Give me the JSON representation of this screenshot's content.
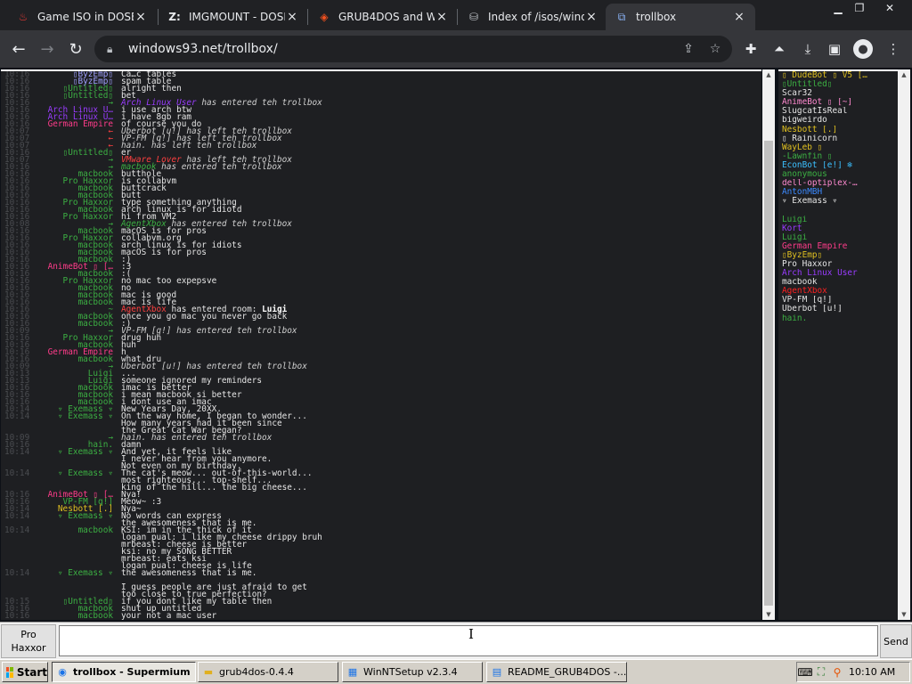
{
  "browser": {
    "tabs": [
      {
        "label": "Game ISO in DOSB",
        "icon": "fire-icon",
        "active": false
      },
      {
        "label": "IMGMOUNT - DOSB",
        "icon": "z-icon",
        "active": false
      },
      {
        "label": "GRUB4DOS and W",
        "icon": "diamond-icon",
        "active": false
      },
      {
        "label": "Index of /isos/windo",
        "icon": "folder-icon",
        "active": false
      },
      {
        "label": "trollbox",
        "icon": "trollbox-icon",
        "active": true
      }
    ],
    "new_tab_close": "×",
    "url": "windows93.net/trollbox/"
  },
  "chat": {
    "messages": [
      {
        "t": "10:16",
        "n": "▯ByzEmp▯",
        "x": "Ca…c tables",
        "nc": "#a0a0ff"
      },
      {
        "t": "10:16",
        "n": "▯ByzEmp▯",
        "x": "spam table",
        "nc": "#a0a0ff"
      },
      {
        "t": "10:16",
        "n": "▯Untitled▯",
        "x": "alright then",
        "nc": "#3cb043"
      },
      {
        "t": "10:16",
        "n": "▯Untitled▯",
        "x": "bet",
        "nc": "#3cb043"
      },
      {
        "t": "10:16",
        "n": "→",
        "x": "Arch Linux User has entered teh trollbox",
        "sys": true,
        "nc": "#3cb043",
        "hl": "Arch Linux User",
        "hc": "#9a3cff"
      },
      {
        "t": "10:16",
        "n": "Arch Linux U…",
        "x": "i use arch btw",
        "nc": "#9a3cff"
      },
      {
        "t": "10:16",
        "n": "Arch Linux U…",
        "x": "i have 8gb ram",
        "nc": "#9a3cff"
      },
      {
        "t": "10:16",
        "n": "German Empire",
        "x": "of course you do",
        "nc": "#ff3c8a"
      },
      {
        "t": "10:07",
        "n": "←",
        "x": "Uberbot [u!] has left teh trollbox",
        "sys": true,
        "nc": "#ff4040"
      },
      {
        "t": "10:07",
        "n": "←",
        "x": "VP-FM [q!] has left teh trollbox",
        "sys": true,
        "nc": "#ff4040"
      },
      {
        "t": "10:07",
        "n": "←",
        "x": "hain. has left teh trollbox",
        "sys": true,
        "nc": "#ff4040"
      },
      {
        "t": "10:16",
        "n": "▯Untitled▯",
        "x": "er",
        "nc": "#3cb043"
      },
      {
        "t": "10:07",
        "n": "→",
        "x": "VMware Lover has left teh trollbox",
        "sys": true,
        "nc": "#3cb043",
        "hl": "VMware Lover",
        "hc": "#ff4040"
      },
      {
        "t": "10:16",
        "n": "→",
        "x": "macbook has entered teh trollbox",
        "sys": true,
        "nc": "#3cb043",
        "hl": "macbook",
        "hc": "#3cb043"
      },
      {
        "t": "10:16",
        "n": "macbook",
        "x": "butthole",
        "nc": "#3cb043"
      },
      {
        "t": "10:16",
        "n": "Pro Haxxor",
        "x": "is collabvm",
        "nc": "#3cb043"
      },
      {
        "t": "10:16",
        "n": "macbook",
        "x": "buttcrack",
        "nc": "#3cb043"
      },
      {
        "t": "10:16",
        "n": "macbook",
        "x": "butt",
        "nc": "#3cb043"
      },
      {
        "t": "10:16",
        "n": "Pro Haxxor",
        "x": "type something anything",
        "nc": "#3cb043"
      },
      {
        "t": "10:16",
        "n": "macbook",
        "x": "arch linux is for idiotd",
        "nc": "#3cb043"
      },
      {
        "t": "10:16",
        "n": "Pro Haxxor",
        "x": "hi from VM2",
        "nc": "#3cb043"
      },
      {
        "t": "10:08",
        "n": "→",
        "x": "AgentXbox has entered teh trollbox",
        "sys": true,
        "nc": "#3cb043",
        "hl": "AgentXbox",
        "hc": "#3cb043"
      },
      {
        "t": "10:16",
        "n": "macbook",
        "x": "macOS is for pros",
        "nc": "#3cb043"
      },
      {
        "t": "10:16",
        "n": "Pro Haxxor",
        "x": "collabvm.org",
        "nc": "#3cb043"
      },
      {
        "t": "10:16",
        "n": "macbook",
        "x": "arch linux is for idiots",
        "nc": "#3cb043"
      },
      {
        "t": "10:16",
        "n": "macbook",
        "x": "macOS is for pros",
        "nc": "#3cb043"
      },
      {
        "t": "10:16",
        "n": "macbook",
        "x": ":)",
        "nc": "#3cb043"
      },
      {
        "t": "10:16",
        "n": "AnimeBot ▯ […",
        "x": ":3",
        "nc": "#ff3c8a"
      },
      {
        "t": "10:16",
        "n": "macbook",
        "x": ":(",
        "nc": "#3cb043"
      },
      {
        "t": "10:16",
        "n": "Pro Haxxor",
        "x": "no mac too expepsve",
        "nc": "#3cb043"
      },
      {
        "t": "10:16",
        "n": "macbook",
        "x": "no",
        "nc": "#3cb043"
      },
      {
        "t": "10:16",
        "n": "macbook",
        "x": "mac is good",
        "nc": "#3cb043"
      },
      {
        "t": "10:16",
        "n": "macbook",
        "x": "mac is life",
        "nc": "#3cb043"
      },
      {
        "t": "10:16",
        "n": "~",
        "x": "AgentXbox has entered room: Luigi",
        "sys": false,
        "nc": "#3cb043",
        "hl": "AgentXbox",
        "hc": "#ff4040",
        "bold": "Luigi"
      },
      {
        "t": "10:16",
        "n": "macbook",
        "x": "once you go mac you never go back",
        "nc": "#3cb043"
      },
      {
        "t": "10:16",
        "n": "macbook",
        "x": ":)",
        "nc": "#3cb043"
      },
      {
        "t": "10:09",
        "n": "→",
        "x": "VP-FM [q!] has entered teh trollbox",
        "sys": true,
        "nc": "#3cb043"
      },
      {
        "t": "10:16",
        "n": "Pro Haxxor",
        "x": "drug huh",
        "nc": "#3cb043"
      },
      {
        "t": "10:16",
        "n": "macbook",
        "x": "huh",
        "nc": "#3cb043"
      },
      {
        "t": "10:16",
        "n": "German Empire",
        "x": "h",
        "nc": "#ff3c8a"
      },
      {
        "t": "10:16",
        "n": "macbook",
        "x": "what dru",
        "nc": "#3cb043"
      },
      {
        "t": "10:09",
        "n": "→",
        "x": "Uberbot [u!] has entered teh trollbox",
        "sys": true,
        "nc": "#3cb043"
      },
      {
        "t": "10:13",
        "n": "Luigi",
        "x": "...",
        "nc": "#3cb043"
      },
      {
        "t": "10:13",
        "n": "Luigi",
        "x": "someone ignored my reminders",
        "nc": "#3cb043"
      },
      {
        "t": "10:16",
        "n": "macbook",
        "x": "imac is better",
        "nc": "#3cb043"
      },
      {
        "t": "10:16",
        "n": "macbook",
        "x": "i mean macbook si better",
        "nc": "#3cb043"
      },
      {
        "t": "10:16",
        "n": "macbook",
        "x": "i dont use an imac",
        "nc": "#3cb043"
      },
      {
        "t": "10:14",
        "n": "▿ Exemass ▿",
        "x": "New Years Day, 20XX.",
        "nc": "#3cb043"
      },
      {
        "t": "10:14",
        "n": "▿ Exemass ▿",
        "x": "On the way home, I began to wonder...",
        "nc": "#3cb043"
      },
      {
        "t": "",
        "n": "",
        "x": "How many years had it been since",
        "nc": "#3cb043"
      },
      {
        "t": "",
        "n": "",
        "x": "the Great Cat War began?",
        "nc": "#3cb043"
      },
      {
        "t": "10:09",
        "n": "→",
        "x": "hain. has entered teh trollbox",
        "sys": true,
        "nc": "#3cb043"
      },
      {
        "t": "10:16",
        "n": "hain.",
        "x": "damn",
        "nc": "#3cb043"
      },
      {
        "t": "10:14",
        "n": "▿ Exemass ▿",
        "x": "And yet, it feels like",
        "nc": "#3cb043"
      },
      {
        "t": "",
        "n": "",
        "x": "I never hear from you anymore.",
        "nc": "#3cb043"
      },
      {
        "t": "",
        "n": "",
        "x": "Not even on my birthday.",
        "nc": "#3cb043"
      },
      {
        "t": "10:14",
        "n": "▿ Exemass ▿",
        "x": "The cat's meow... out-of-this-world...",
        "nc": "#3cb043"
      },
      {
        "t": "",
        "n": "",
        "x": "most righteous... top-shelf...",
        "nc": "#3cb043"
      },
      {
        "t": "",
        "n": "",
        "x": "king of the hill... the big cheese...",
        "nc": "#3cb043"
      },
      {
        "t": "10:16",
        "n": "AnimeBot ▯ […",
        "x": "Nya!",
        "nc": "#ff3c8a"
      },
      {
        "t": "10:16",
        "n": "VP-FM [q!]",
        "x": "Meow~ :3",
        "nc": "#3cb043"
      },
      {
        "t": "10:14",
        "n": "Nesbott [.]",
        "x": "Nya~",
        "nc": "#e0c020"
      },
      {
        "t": "10:14",
        "n": "▿ Exemass ▿",
        "x": "No words can express",
        "nc": "#3cb043"
      },
      {
        "t": "",
        "n": "",
        "x": "the awesomeness that is me.",
        "nc": "#3cb043"
      },
      {
        "t": "10:14",
        "n": "macbook",
        "x": "KSI: im in the thick of it",
        "nc": "#3cb043"
      },
      {
        "t": "",
        "n": "",
        "x": "logan pual: i like my cheese drippy bruh",
        "nc": "#3cb043"
      },
      {
        "t": "",
        "n": "",
        "x": "mrbeast: cheese is better",
        "nc": "#3cb043"
      },
      {
        "t": "",
        "n": "",
        "x": "ksi: no my SONG BETTER",
        "nc": "#3cb043"
      },
      {
        "t": "",
        "n": "",
        "x": "mrbeast: eats ksi",
        "nc": "#3cb043"
      },
      {
        "t": "",
        "n": "",
        "x": "logan pual: cheese is life",
        "nc": "#3cb043"
      },
      {
        "t": "10:14",
        "n": "▿ Exemass ▿",
        "x": "the awesomeness that is me.",
        "nc": "#3cb043"
      },
      {
        "t": "",
        "n": "",
        "x": "",
        "nc": "#3cb043"
      },
      {
        "t": "",
        "n": "",
        "x": "I guess people are just afraid to get",
        "nc": "#3cb043"
      },
      {
        "t": "",
        "n": "",
        "x": "too close to true perfection?",
        "nc": "#3cb043"
      },
      {
        "t": "10:15",
        "n": "▯Untitled▯",
        "x": "if you dont like my table then",
        "nc": "#3cb043"
      },
      {
        "t": "10:16",
        "n": "macbook",
        "x": "shut up untitled",
        "nc": "#3cb043"
      },
      {
        "t": "10:16",
        "n": "macbook",
        "x": "your not a mac user",
        "nc": "#3cb043"
      }
    ]
  },
  "users": [
    {
      "n": "▯ DudeBot ▯  V5 […",
      "c": "#e0c020"
    },
    {
      "n": "▯Untitled▯",
      "c": "#3cb043"
    },
    {
      "n": "Scar32",
      "c": "#e6e6e6"
    },
    {
      "n": "AnimeBot ▯ [~]",
      "c": "#ff8ad0"
    },
    {
      "n": "SlugcatIsReal",
      "c": "#e6e6e6"
    },
    {
      "n": "bigweirdo",
      "c": "#e6e6e6"
    },
    {
      "n": "Nesbott [.]",
      "c": "#e0c020"
    },
    {
      "n": "▯ Rainicorn",
      "c": "#e6e6e6"
    },
    {
      "n": "WayLeb ▯",
      "c": "#e0c020"
    },
    {
      "n": "-Lawnfin ▯",
      "c": "#3cb043"
    },
    {
      "n": "EconBot [e!] ❄",
      "c": "#3cc0ff"
    },
    {
      "n": "anonymous",
      "c": "#3cb043"
    },
    {
      "n": "dell-optiplex-…",
      "c": "#ff8ad0"
    },
    {
      "n": "AntonMBH",
      "c": "#3c8aff"
    },
    {
      "n": "▿ Exemass ▿",
      "c": "#e6e6e6"
    },
    {
      "n": "Luigi",
      "c": "#1e1f22"
    },
    {
      "n": "Luigi",
      "c": "#3cb043"
    },
    {
      "n": "Kort",
      "c": "#9a3cff"
    },
    {
      "n": "Luigi",
      "c": "#3cb043"
    },
    {
      "n": "German Empire",
      "c": "#ff3c8a"
    },
    {
      "n": "▯ByzEmp▯",
      "c": "#e0c020"
    },
    {
      "n": "Pro Haxxor",
      "c": "#e6e6e6"
    },
    {
      "n": "Arch Linux User",
      "c": "#9a3cff"
    },
    {
      "n": "macbook",
      "c": "#e6e6e6"
    },
    {
      "n": "AgentXbox",
      "c": "#ff2020"
    },
    {
      "n": "VP-FM [q!]",
      "c": "#e6e6e6"
    },
    {
      "n": "Uberbot [u!]",
      "c": "#e6e6e6"
    },
    {
      "n": "hain.",
      "c": "#3cb043"
    }
  ],
  "input": {
    "nick": "Pro\nHaxxor",
    "value": "",
    "send": "Send"
  },
  "taskbar": {
    "start": "Start",
    "items": [
      {
        "label": "trollbox - Supermium",
        "active": true,
        "icon": "supermium-icon"
      },
      {
        "label": "grub4dos-0.4.4",
        "active": false,
        "icon": "folder-icon"
      },
      {
        "label": "WinNTSetup v2.3.4",
        "active": false,
        "icon": "setup-icon"
      },
      {
        "label": "README_GRUB4DOS -...",
        "active": false,
        "icon": "notepad-icon"
      }
    ],
    "clock": "10:10 AM"
  },
  "colors": {
    "chat_bg": "#1e1f22",
    "timestamp": "#4a4c50",
    "default_nick": "#3cb043"
  }
}
